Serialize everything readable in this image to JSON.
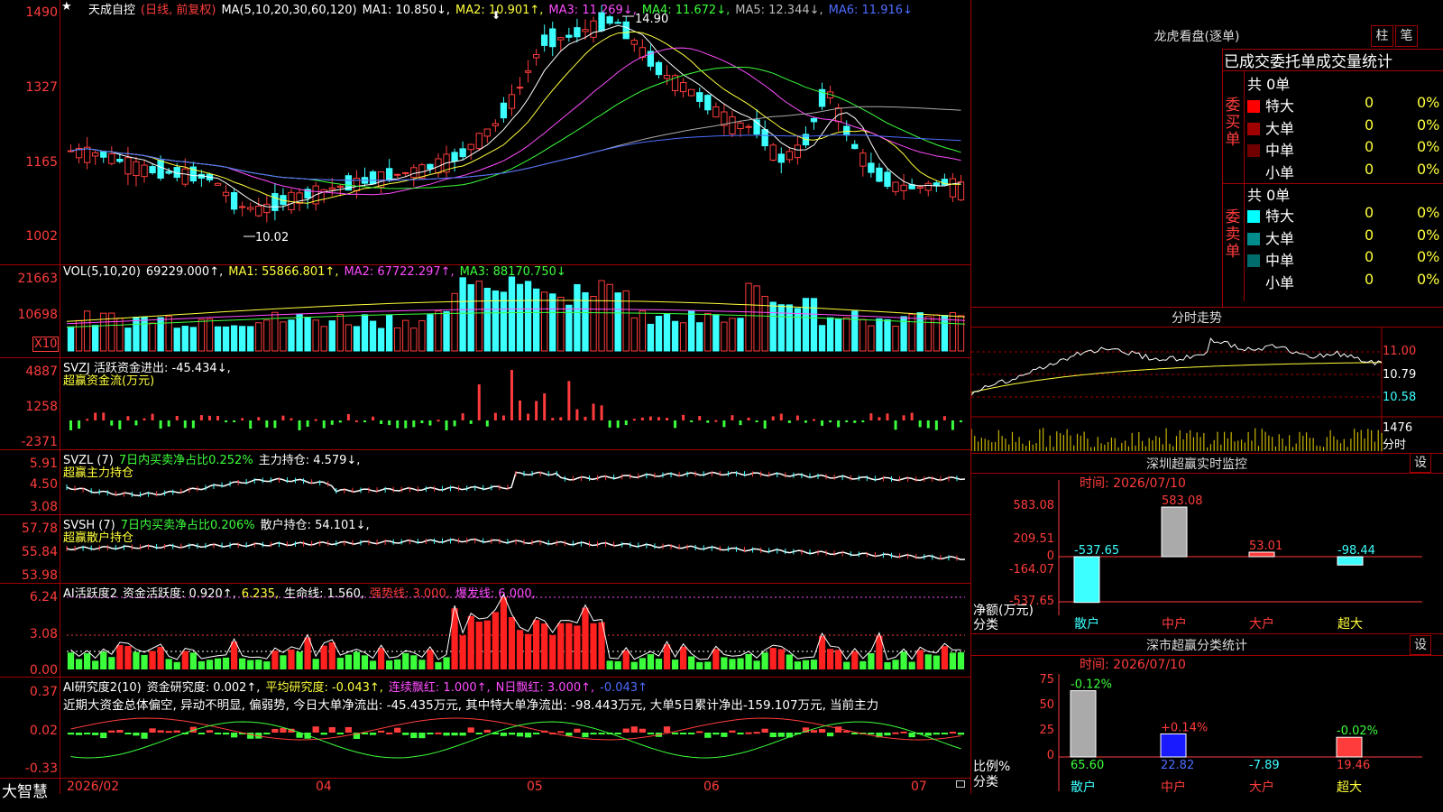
{
  "main_chart": {
    "symbol_name": "天成自控",
    "period_label": "(日线, 前复权)",
    "ma_spec": "MA(5,10,20,30,60,120)",
    "ma1": "MA1: 10.850↓,",
    "ma2": "MA2: 10.901↑,",
    "ma3": "MA3: 11.269↓,",
    "ma4": "MA4: 11.672↓,",
    "ma5": "MA5: 12.344↓,",
    "ma6": "MA6: 11.916↓",
    "y_ticks": [
      "1490",
      "1327",
      "1165",
      "1002"
    ],
    "high_marker": "14.90",
    "low_marker": "10.02",
    "star_icon": "★",
    "arrow_icon": "⬇"
  },
  "volume": {
    "spec": "VOL(5,10,20)",
    "value": "69229.000↑,",
    "ma1": "MA1: 55866.801↑,",
    "ma2": "MA2: 67722.297↑,",
    "ma3": "MA3: 88170.750↓",
    "y_ticks": [
      "21663",
      "10698"
    ],
    "unit": "X10"
  },
  "svzj": {
    "label": "SVZJ  活跃资金进出: -45.434↓,",
    "sub": "超赢资金流(万元)",
    "y_ticks": [
      "4887",
      "1258",
      "-2371"
    ]
  },
  "svzl": {
    "label": "SVZL (7)",
    "ratio": "7日内买卖净占比0.252%",
    "hold": "主力持仓: 4.579↓,",
    "sub": "超赢主力持仓",
    "y_ticks": [
      "5.91",
      "4.50",
      "3.08"
    ]
  },
  "svsh": {
    "label": "SVSH (7)",
    "ratio": "7日内买卖净占比0.206%",
    "hold": "散户持仓: 54.101↓,",
    "sub": "超赢散户持仓",
    "y_ticks": [
      "57.78",
      "55.84",
      "53.98"
    ]
  },
  "ai_active": {
    "label": "AI活跃度2",
    "v1": "资金活跃度: 0.920↑,",
    "v2": "6.235,",
    "v3": "生命线: 1.560,",
    "v4": "强势线: 3.000,",
    "v5": "爆发线: 6.000,",
    "y_ticks": [
      "6.24",
      "3.08",
      "0.00"
    ]
  },
  "ai_research": {
    "label": "AI研究度2(10)",
    "v1": "资金研究度: 0.002↑,",
    "v2": "平均研究度: -0.043↑,",
    "v3": "连续飘红: 1.000↑,",
    "v4": "N日飘红: 3.000↑,",
    "v5": "-0.043↑",
    "summary": "近期大资金总体偏空, 异动不明显, 偏弱势, 今日大单净流出: -45.435万元, 其中特大单净流出: -98.443万元, 大单5日累计净出-159.107万元, 当前主力",
    "y_ticks": [
      "0.37",
      "0.02",
      "-0.33"
    ]
  },
  "x_axis": {
    "brand": "大智慧",
    "labels": [
      "2026/02",
      "04",
      "05",
      "06",
      "07"
    ]
  },
  "right_top": {
    "title": "龙虎看盘(逐单)",
    "btn1": "柱",
    "btn2": "笔",
    "header": "已成交委托单成交量统计",
    "buy_side": "委买单",
    "sell_side": "委卖单",
    "buy_total": "共 0单",
    "sell_total": "共 0单",
    "buy_rows": [
      {
        "name": "特大",
        "count": "0",
        "pct": "0%",
        "color": "#ff0000"
      },
      {
        "name": "大单",
        "count": "0",
        "pct": "0%",
        "color": "#a00000"
      },
      {
        "name": "中单",
        "count": "0",
        "pct": "0%",
        "color": "#700000"
      },
      {
        "name": "小单",
        "count": "0",
        "pct": "0%",
        "color": "#000000"
      }
    ],
    "sell_rows": [
      {
        "name": "特大",
        "count": "0",
        "pct": "0%",
        "color": "#00ffff"
      },
      {
        "name": "大单",
        "count": "0",
        "pct": "0%",
        "color": "#008c8c"
      },
      {
        "name": "中单",
        "count": "0",
        "pct": "0%",
        "color": "#006c6c"
      },
      {
        "name": "小单",
        "count": "0",
        "pct": "0%",
        "color": "#000000"
      }
    ]
  },
  "intraday": {
    "title": "分时走势",
    "y_ticks": [
      "11.00",
      "10.79",
      "10.58"
    ],
    "vol_tick": "1476",
    "vol_unit": "分时"
  },
  "sz_monitor": {
    "title": "深圳超赢实时监控",
    "btn": "设",
    "time": "时间: 2026/07/10",
    "y_ticks": [
      "583.08",
      "209.51",
      "0",
      "-164.07",
      "-537.65"
    ],
    "unit": "净额(万元)",
    "cat_label": "分类",
    "categories": [
      "散户",
      "中户",
      "大户",
      "超大"
    ],
    "values": [
      -537.65,
      583.08,
      53.01,
      -98.44
    ],
    "value_labels": [
      "-537.65",
      "583.08",
      "53.01",
      "-98.44"
    ]
  },
  "sz_class": {
    "title": "深市超赢分类统计",
    "btn": "设",
    "time": "时间: 2026/07/10",
    "y_ticks": [
      "75",
      "50",
      "25",
      "0"
    ],
    "unit": "比例%",
    "cat_label": "分类",
    "categories": [
      "散户",
      "中户",
      "大户",
      "超大"
    ],
    "values": [
      65.6,
      22.82,
      -7.89,
      19.46
    ],
    "value_labels": [
      "65.60",
      "22.82",
      "-7.89",
      "19.46"
    ],
    "changes": [
      "-0.12%",
      "+0.14%",
      "",
      "-0.02%"
    ]
  }
}
